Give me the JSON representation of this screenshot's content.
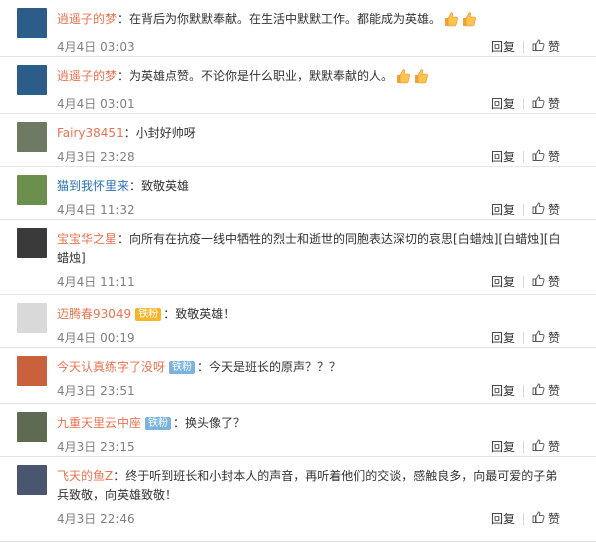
{
  "comments": [
    {
      "user": "逍遥子的梦",
      "sep": "：",
      "text": "在背后为你默默奉献。在生活中默默工作。都能成为英雄。",
      "emoji_count": 2,
      "badge": "",
      "date": "4月4日",
      "time": "03:03",
      "reply": "回复",
      "like": "赞",
      "avatar_color": "#2c5d8a"
    },
    {
      "user": "逍遥子的梦",
      "sep": "：",
      "text": "为英雄点赞。不论你是什么职业，默默奉献的人。",
      "emoji_count": 2,
      "badge": "",
      "date": "4月4日",
      "time": "03:01",
      "reply": "回复",
      "like": "赞",
      "avatar_color": "#2c5d8a"
    },
    {
      "user": "Fairy38451",
      "sep": "：",
      "text": "小封好帅呀",
      "emoji_count": 0,
      "badge": "",
      "date": "4月3日",
      "time": "23:28",
      "reply": "回复",
      "like": "赞",
      "avatar_color": "#6e7a64"
    },
    {
      "user": "猫到我怀里来",
      "sep": "：",
      "text": "致敬英雄",
      "emoji_count": 0,
      "badge": "",
      "date": "4月4日",
      "time": "11:32",
      "reply": "回复",
      "like": "赞",
      "avatar_color": "#6d8f4d"
    },
    {
      "user": "宝宝华之星",
      "sep": "：",
      "text": "向所有在抗疫一线中牺牲的烈士和逝世的同胞表达深切的哀思[白蜡烛][白蜡烛][白蜡烛]",
      "emoji_count": 0,
      "badge": "",
      "date": "4月4日",
      "time": "11:11",
      "reply": "回复",
      "like": "赞",
      "avatar_color": "#3a3a3a"
    },
    {
      "user": "迈腾春93049",
      "sep": "：",
      "text": "致敬英雄！",
      "emoji_count": 0,
      "badge": "铁粉",
      "badge_gold": true,
      "date": "4月4日",
      "time": "00:19",
      "reply": "回复",
      "like": "赞",
      "avatar_color": "#d9d9d9"
    },
    {
      "user": "今天认真练字了没呀",
      "sep": "：",
      "text": "今天是班长的原声？？？",
      "emoji_count": 0,
      "badge": "铁粉",
      "badge_gold": false,
      "date": "4月3日",
      "time": "23:51",
      "reply": "回复",
      "like": "赞",
      "avatar_color": "#c8613c"
    },
    {
      "user": "九重天里云中座",
      "sep": "：",
      "text": "换头像了？",
      "emoji_count": 0,
      "badge": "铁粉",
      "badge_gold": false,
      "date": "4月3日",
      "time": "23:15",
      "reply": "回复",
      "like": "赞",
      "avatar_color": "#5e6b52"
    },
    {
      "user": "飞天的鱼Z",
      "sep": "：",
      "text": "终于听到班长和小封本人的声音，再听着他们的交谈，感触良多，向最可爱的子弟兵致敬，向英雄致敬！",
      "emoji_count": 0,
      "badge": "",
      "date": "4月3日",
      "time": "22:46",
      "reply": "回复",
      "like": "赞",
      "avatar_color": "#4a5570"
    }
  ]
}
